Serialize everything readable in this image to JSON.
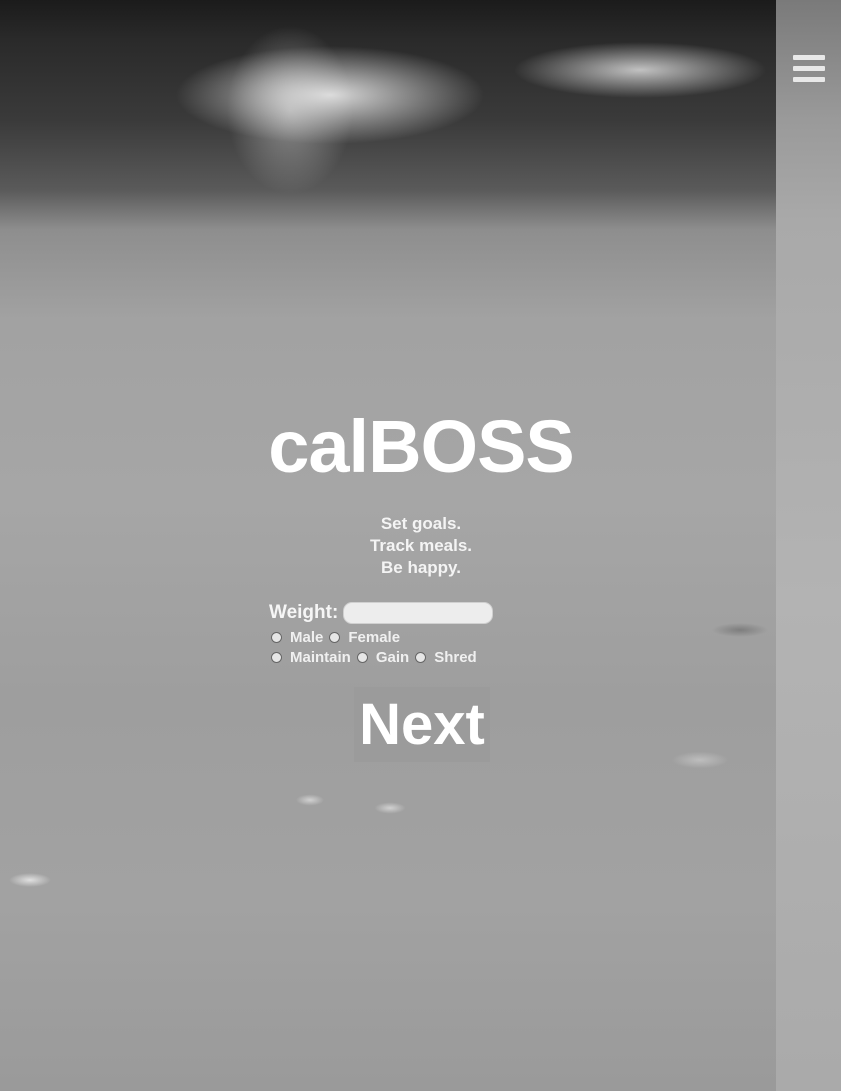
{
  "app": {
    "name": "calBOSS"
  },
  "taglines": [
    "Set goals.",
    "Track meals.",
    "Be happy."
  ],
  "form": {
    "weight_label": "Weight:",
    "weight_value": "",
    "gender_options": [
      "Male",
      "Female"
    ],
    "goal_options": [
      "Maintain",
      "Gain",
      "Shred"
    ]
  },
  "next_button_label": "Next",
  "icons": {
    "menu": "hamburger-menu-icon"
  }
}
